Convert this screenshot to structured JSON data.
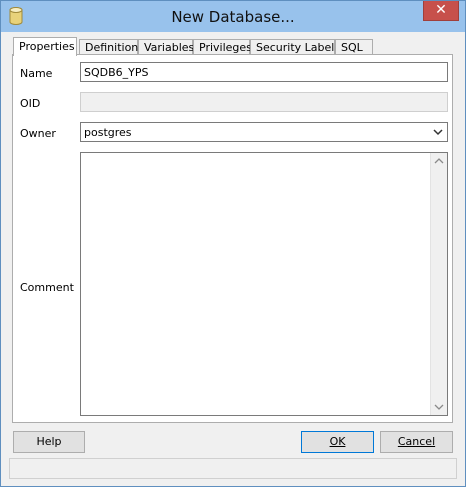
{
  "window": {
    "title": "New Database...",
    "close_glyph": "✕"
  },
  "tabs": [
    {
      "label": "Properties",
      "active": true
    },
    {
      "label": "Definition",
      "active": false
    },
    {
      "label": "Variables",
      "active": false
    },
    {
      "label": "Privileges",
      "active": false
    },
    {
      "label": "Security Labels",
      "active": false
    },
    {
      "label": "SQL",
      "active": false
    }
  ],
  "form": {
    "name_label": "Name",
    "name_value": "SQDB6_YPS",
    "oid_label": "OID",
    "oid_value": "",
    "owner_label": "Owner",
    "owner_value": "postgres",
    "comment_label": "Comment",
    "comment_value": ""
  },
  "buttons": {
    "help": "Help",
    "ok": "OK",
    "cancel": "Cancel"
  },
  "icons": {
    "title": "database-icon",
    "close": "close-icon",
    "dropdown": "chevron-down-icon",
    "scroll_up": "chevron-up-icon",
    "scroll_down": "chevron-down-icon"
  }
}
